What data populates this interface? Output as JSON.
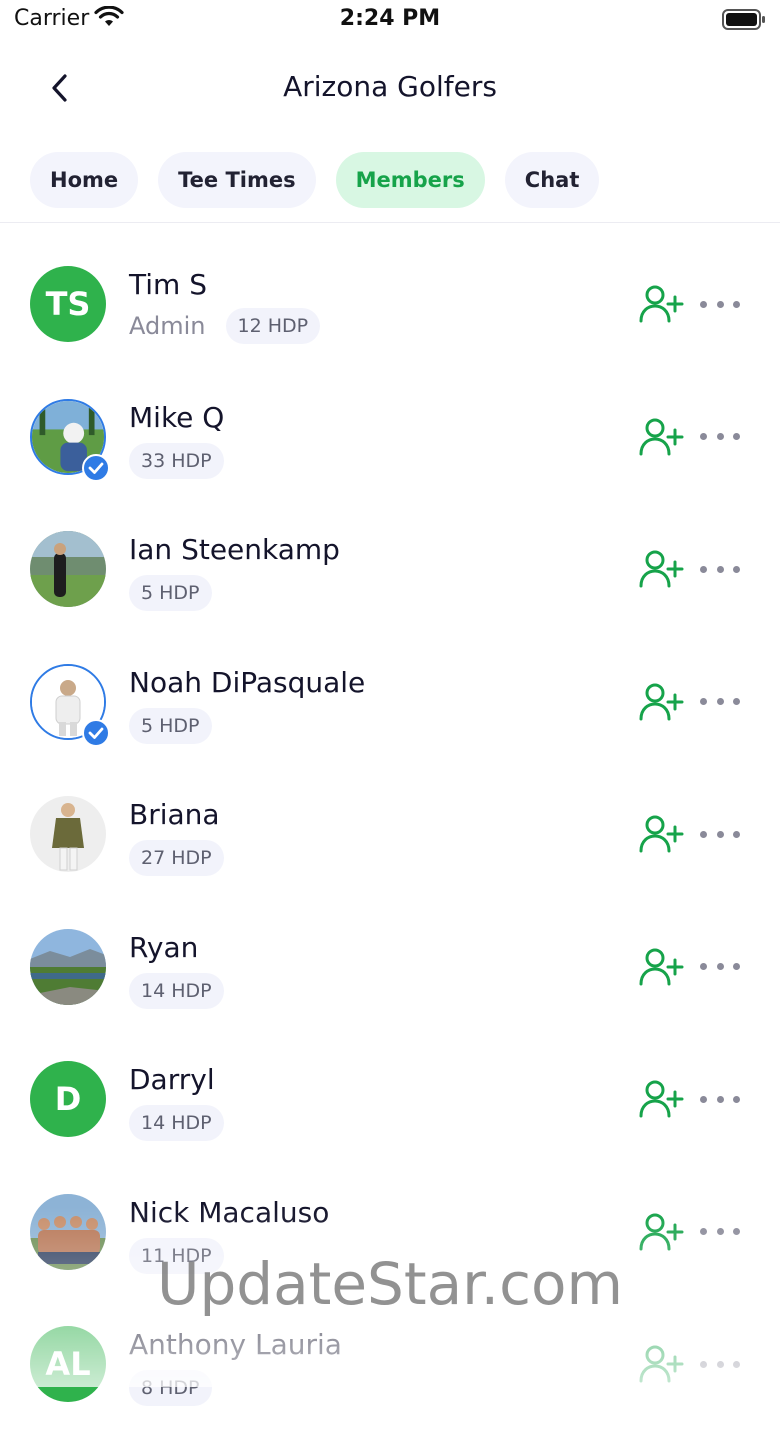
{
  "status": {
    "carrier": "Carrier",
    "time": "2:24 PM"
  },
  "nav": {
    "title": "Arizona Golfers"
  },
  "tabs": [
    {
      "label": "Home",
      "active": false
    },
    {
      "label": "Tee Times",
      "active": false
    },
    {
      "label": "Members",
      "active": true
    },
    {
      "label": "Chat",
      "active": false
    }
  ],
  "members": [
    {
      "name": "Tim S",
      "initials": "TS",
      "role": "Admin",
      "hdp": "12 HDP",
      "avatar": "initials",
      "verified": false
    },
    {
      "name": "Mike Q",
      "hdp": "33 HDP",
      "avatar": "photo-golf-course",
      "verified": true
    },
    {
      "name": "Ian Steenkamp",
      "hdp": "5 HDP",
      "avatar": "photo-golfer-swing",
      "verified": false
    },
    {
      "name": "Noah DiPasquale",
      "hdp": "5 HDP",
      "avatar": "photo-golfer-white",
      "verified": true
    },
    {
      "name": "Briana",
      "hdp": "27 HDP",
      "avatar": "photo-person-jacket",
      "verified": false
    },
    {
      "name": "Ryan",
      "hdp": "14 HDP",
      "avatar": "photo-landscape",
      "verified": false
    },
    {
      "name": "Darryl",
      "initials": "D",
      "hdp": "14 HDP",
      "avatar": "initials",
      "verified": false
    },
    {
      "name": "Nick Macaluso",
      "hdp": "11 HDP",
      "avatar": "photo-group",
      "verified": false
    },
    {
      "name": "Anthony Lauria",
      "initials": "AL",
      "hdp": "8 HDP",
      "avatar": "initials",
      "verified": false
    }
  ],
  "icons": {
    "add": "add-friend-icon",
    "more": "more-icon",
    "back": "chevron-left-icon"
  },
  "colors": {
    "accent": "#16a34a",
    "avatar_green": "#2fb24c",
    "verified_blue": "#2f7be5"
  },
  "watermark": "UpdateStar.com"
}
